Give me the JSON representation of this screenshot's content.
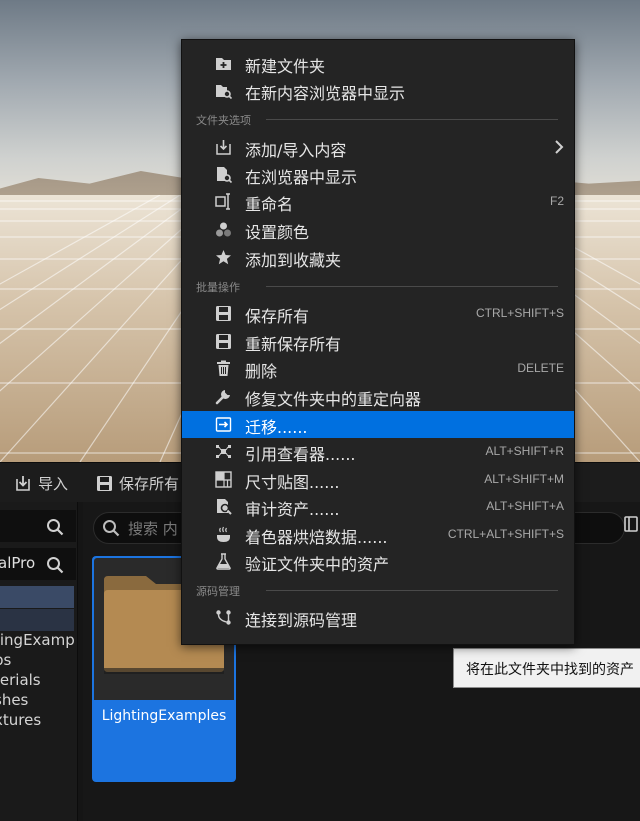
{
  "toolbar": {
    "import_label": "导入",
    "save_all_label": "保存所有"
  },
  "left_panel": {
    "search_partial": "alPro",
    "tree": [
      "tingExamp",
      "ps",
      "terials",
      "shes",
      "xtures"
    ]
  },
  "right_panel": {
    "search_placeholder": "搜索 内",
    "folder_name": "LightingExamples"
  },
  "tooltip": "将在此文件夹中找到的资产",
  "menu": {
    "top_items": [
      {
        "label": "新建文件夹",
        "icon": "new-folder-icon"
      },
      {
        "label": "在新内容浏览器中显示",
        "icon": "folder-search-icon"
      }
    ],
    "sections": [
      {
        "title": "文件夹选项"
      },
      {
        "title": "批量操作"
      },
      {
        "title": "源码管理"
      }
    ],
    "folder_options": [
      {
        "label": "添加/导入内容",
        "icon": "import-icon",
        "submenu": true
      },
      {
        "label": "在浏览器中显示",
        "icon": "show-in-explorer-icon"
      },
      {
        "label": "重命名",
        "icon": "rename-icon",
        "shortcut": "F2"
      },
      {
        "label": "设置颜色",
        "icon": "color-icon"
      },
      {
        "label": "添加到收藏夹",
        "icon": "star-icon"
      }
    ],
    "bulk_ops": [
      {
        "label": "保存所有",
        "icon": "save-icon",
        "shortcut": "CTRL+SHIFT+S"
      },
      {
        "label": "重新保存所有",
        "icon": "resave-icon"
      },
      {
        "label": "删除",
        "icon": "trash-icon",
        "shortcut": "DELETE"
      },
      {
        "label": "修复文件夹中的重定向器",
        "icon": "wrench-icon"
      },
      {
        "label": "迁移......",
        "icon": "migrate-icon",
        "highlighted": true
      },
      {
        "label": "引用查看器......",
        "icon": "reference-viewer-icon",
        "shortcut": "ALT+SHIFT+R"
      },
      {
        "label": "尺寸贴图......",
        "icon": "size-map-icon",
        "shortcut": "ALT+SHIFT+M"
      },
      {
        "label": "审计资产......",
        "icon": "audit-icon",
        "shortcut": "ALT+SHIFT+A"
      },
      {
        "label": "着色器烘焙数据......",
        "icon": "shader-cook-icon",
        "shortcut": "CTRL+ALT+SHIFT+S"
      },
      {
        "label": "验证文件夹中的资产",
        "icon": "flask-icon"
      }
    ],
    "source_control": [
      {
        "label": "连接到源码管理",
        "icon": "source-control-icon"
      }
    ]
  },
  "colors": {
    "menu_bg": "#242424",
    "highlight": "#0070e0",
    "selected_tile": "#1c74e0",
    "folder": "#b48a52"
  }
}
